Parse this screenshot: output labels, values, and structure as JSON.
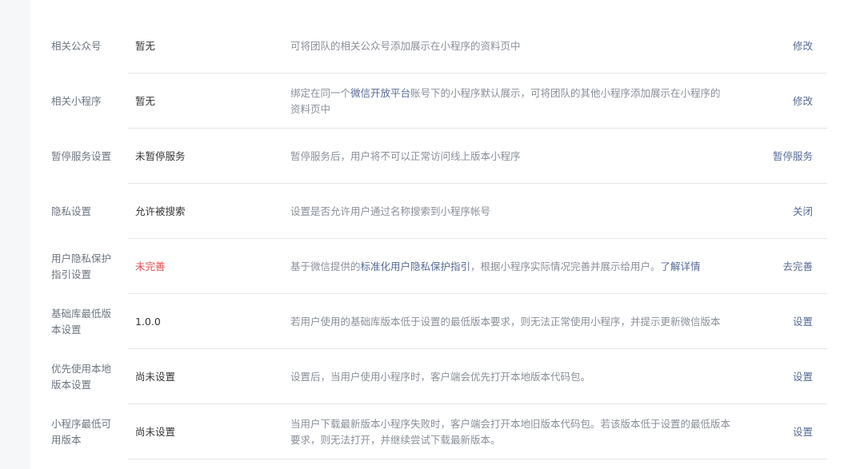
{
  "settings": [
    {
      "label": "相关公众号",
      "value": "暂无",
      "desc": [
        "可将团队的相关公众号添加展示在小程序的资料页中"
      ],
      "action": "修改"
    },
    {
      "label": "相关小程序",
      "value": "暂无",
      "desc_prefix": "绑定在同一个",
      "desc_link": "微信开放平台",
      "desc_suffix": "账号下的小程序默认展示，可将团队的其他小程序添加展示在小程序的资料页中",
      "action": "修改"
    },
    {
      "label": "暂停服务设置",
      "value": "未暂停服务",
      "desc": [
        "暂停服务后，用户将不可以正常访问线上版本小程序"
      ],
      "action": "暂停服务"
    },
    {
      "label": "隐私设置",
      "value": "允许被搜索",
      "desc": [
        "设置是否允许用户通过名称搜索到小程序帐号"
      ],
      "action": "关闭"
    },
    {
      "label": "用户隐私保护指引设置",
      "value": "未完善",
      "value_color": "#e54b4b",
      "desc_prefix": "基于微信提供的",
      "desc_link": "标准化用户隐私保护指引",
      "desc_middle": "，根据小程序实际情况完善并展示给用户。",
      "desc_link2": "了解详情",
      "action": "去完善"
    },
    {
      "label": "基础库最低版本设置",
      "value": "1.0.0",
      "desc": [
        "若用户使用的基础库版本低于设置的最低版本要求，则无法正常使用小程序，并提示更新微信版本"
      ],
      "action": "设置"
    },
    {
      "label": "优先使用本地版本设置",
      "value": "尚未设置",
      "desc": [
        "设置后，当用户使用小程序时，客户端会优先打开本地版本代码包。"
      ],
      "action": "设置"
    },
    {
      "label": "小程序最低可用版本",
      "value": "尚未设置",
      "desc": [
        "当用户下载最新版本小程序失败时，客户端会打开本地旧版本代码包。若该版本低于设置的最低版本要求，则无法打开，并继续尝试下载最新版本。"
      ],
      "action": "设置"
    }
  ],
  "colors": {
    "label": "#6e7580",
    "value": "#353535",
    "desc": "#8a8f99",
    "link": "#576b95",
    "warn": "#e54b4b",
    "divider": "#e7e7eb"
  }
}
